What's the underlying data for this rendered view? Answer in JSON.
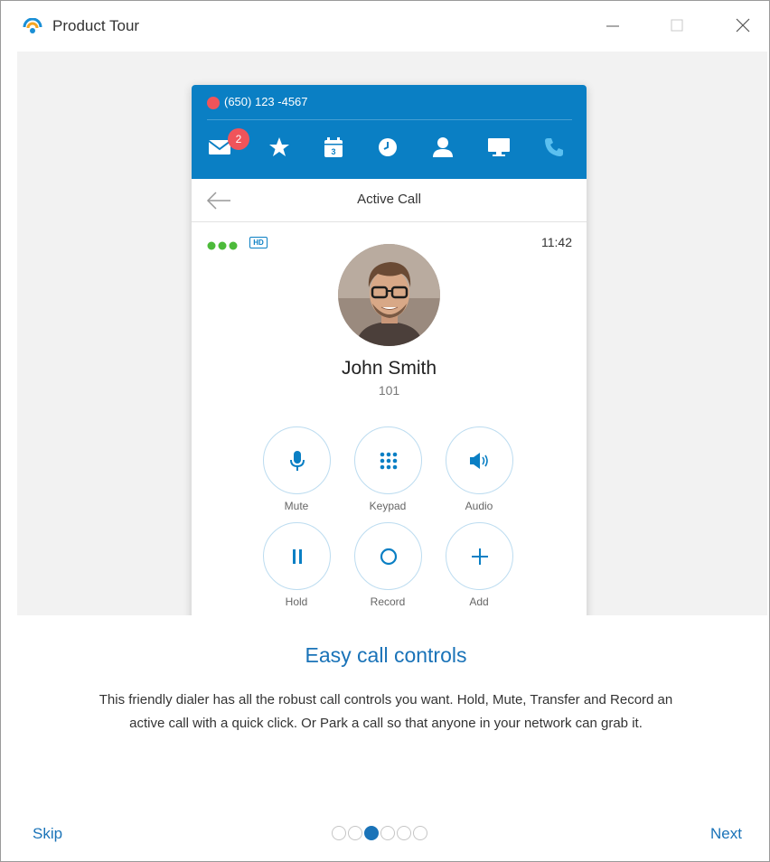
{
  "window": {
    "title": "Product Tour"
  },
  "phone": {
    "number": "(650) 123 -4567",
    "voicemail_count": "2",
    "nav_title": "Active Call",
    "hd_label": "HD",
    "call_timer": "11:42",
    "contact_name": "John Smith",
    "contact_extension": "101",
    "controls": [
      {
        "label": "Mute",
        "icon": "microphone-icon"
      },
      {
        "label": "Keypad",
        "icon": "keypad-icon"
      },
      {
        "label": "Audio",
        "icon": "speaker-icon"
      },
      {
        "label": "Hold",
        "icon": "pause-icon"
      },
      {
        "label": "Record",
        "icon": "record-icon"
      },
      {
        "label": "Add",
        "icon": "plus-icon"
      }
    ],
    "toolbar_icons": [
      "mail-icon",
      "star-icon",
      "calendar-icon",
      "clock-icon",
      "contacts-icon",
      "monitor-icon",
      "phone-icon"
    ],
    "accent_color": "#0a7fc4",
    "status_color": "#f0545a"
  },
  "tour": {
    "heading": "Easy call controls",
    "description": "This friendly dialer has all the robust call controls you want. Hold, Mute, Transfer and Record an active call with a quick click. Or Park a call so that anyone in your network can grab it.",
    "skip_label": "Skip",
    "next_label": "Next",
    "page_count": 6,
    "current_page": 3
  }
}
